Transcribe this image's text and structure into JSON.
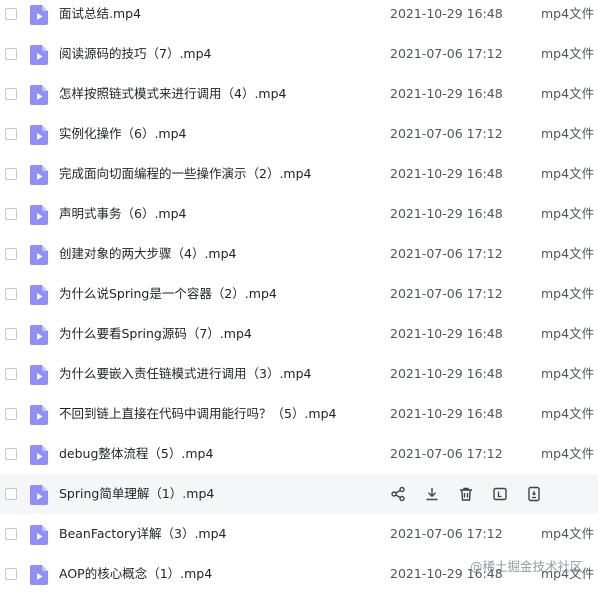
{
  "colors": {
    "icon_fill": "#8f8ff7",
    "icon_fold": "#c5c5fb",
    "row_hover_bg": "#f5f6f8",
    "action_icon": "#3d4350"
  },
  "files": [
    {
      "name": "面试总结.mp4",
      "date": "2021-10-29 16:48",
      "type": "mp4文件",
      "hovered": false
    },
    {
      "name": "阅读源码的技巧（7）.mp4",
      "date": "2021-07-06 17:12",
      "type": "mp4文件",
      "hovered": false
    },
    {
      "name": "怎样按照链式模式来进行调用（4）.mp4",
      "date": "2021-10-29 16:48",
      "type": "mp4文件",
      "hovered": false
    },
    {
      "name": "实例化操作（6）.mp4",
      "date": "2021-07-06 17:12",
      "type": "mp4文件",
      "hovered": false
    },
    {
      "name": "完成面向切面编程的一些操作演示（2）.mp4",
      "date": "2021-10-29 16:48",
      "type": "mp4文件",
      "hovered": false
    },
    {
      "name": "声明式事务（6）.mp4",
      "date": "2021-10-29 16:48",
      "type": "mp4文件",
      "hovered": false
    },
    {
      "name": "创建对象的两大步骤（4）.mp4",
      "date": "2021-07-06 17:12",
      "type": "mp4文件",
      "hovered": false
    },
    {
      "name": "为什么说Spring是一个容器（2）.mp4",
      "date": "2021-07-06 17:12",
      "type": "mp4文件",
      "hovered": false
    },
    {
      "name": "为什么要看Spring源码（7）.mp4",
      "date": "2021-10-29 16:48",
      "type": "mp4文件",
      "hovered": false
    },
    {
      "name": "为什么要嵌入责任链模式进行调用（3）.mp4",
      "date": "2021-10-29 16:48",
      "type": "mp4文件",
      "hovered": false
    },
    {
      "name": "不回到链上直接在代码中调用能行吗？（5）.mp4",
      "date": "2021-10-29 16:48",
      "type": "mp4文件",
      "hovered": false
    },
    {
      "name": "debug整体流程（5）.mp4",
      "date": "2021-07-06 17:12",
      "type": "mp4文件",
      "hovered": false
    },
    {
      "name": "Spring简单理解（1）.mp4",
      "date": "",
      "type": "",
      "hovered": true
    },
    {
      "name": "BeanFactory详解（3）.mp4",
      "date": "2021-07-06 17:12",
      "type": "mp4文件",
      "hovered": false
    },
    {
      "name": "AOP的核心概念（1）.mp4",
      "date": "2021-10-29 16:48",
      "type": "mp4文件",
      "hovered": false
    }
  ],
  "hover_actions": [
    {
      "name": "share-icon"
    },
    {
      "name": "download-icon"
    },
    {
      "name": "delete-icon"
    },
    {
      "name": "rename-icon"
    },
    {
      "name": "more-icon"
    }
  ],
  "watermark": "@稀土掘金技术社区"
}
